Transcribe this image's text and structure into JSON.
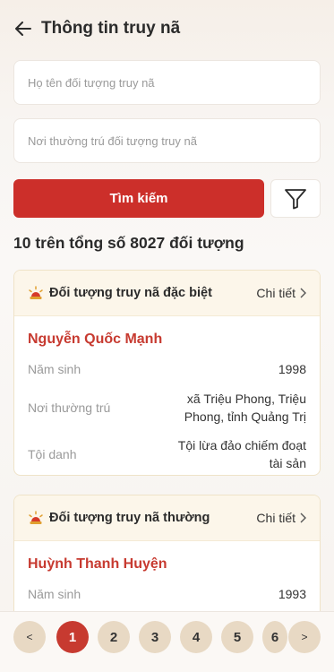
{
  "header": {
    "title": "Thông tin truy nã"
  },
  "search": {
    "name_placeholder": "Họ tên đối tượng truy nã",
    "address_placeholder": "Nơi thường trú đối tượng truy nã",
    "button_label": "Tìm kiếm"
  },
  "results": {
    "count_text": "10 trên tổng số 8027 đối tượng"
  },
  "cards": [
    {
      "type": "Đối tượng truy nã đặc biệt",
      "detail_label": "Chi tiết",
      "name": "Nguyễn Quốc Mạnh",
      "birth_label": "Năm sinh",
      "birth_year": "1998",
      "address_label": "Nơi thường trú",
      "address": "xã Triệu Phong, Triệu Phong, tỉnh Quảng Trị",
      "crime_label": "Tội danh",
      "crime": "Tội lừa đảo chiếm đoạt tài sản"
    },
    {
      "type": "Đối tượng truy nã thường",
      "detail_label": "Chi tiết",
      "name": "Huỳnh Thanh Huyện",
      "birth_label": "Năm sinh",
      "birth_year": "1993"
    }
  ],
  "pagination": {
    "prev": "<",
    "next": ">",
    "pages": [
      "1",
      "2",
      "3",
      "4",
      "5",
      "6"
    ],
    "current": "1"
  },
  "colors": {
    "accent": "#cc2f2a",
    "name_red": "#c73a30",
    "page_chip": "#e8d9c4"
  }
}
